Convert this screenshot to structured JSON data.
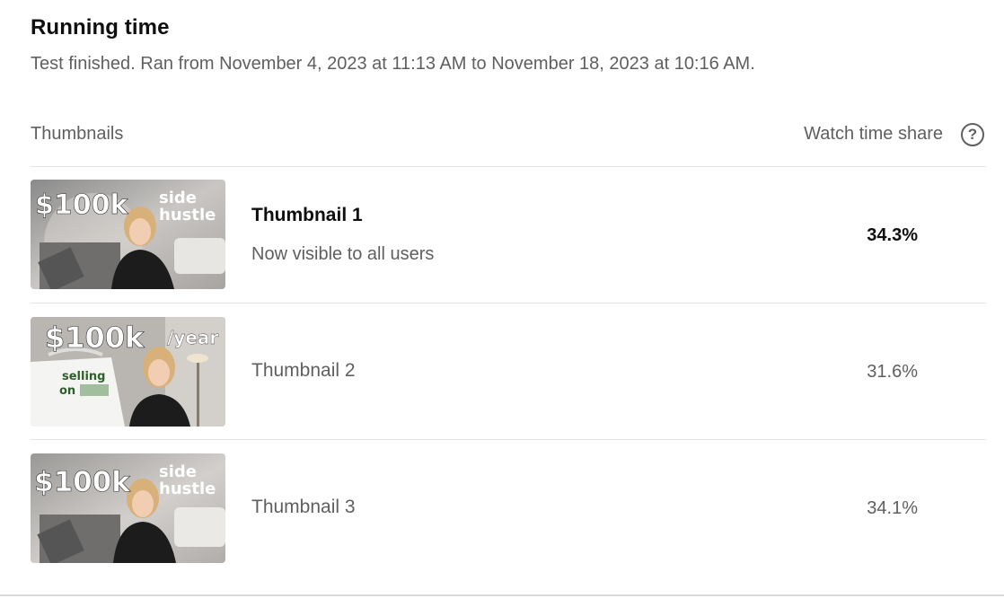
{
  "running_time": {
    "title": "Running time",
    "description": "Test finished. Ran from November 4, 2023 at 11:13 AM to November 18, 2023 at 10:16 AM."
  },
  "table": {
    "col_thumbnails": "Thumbnails",
    "col_watch_share": "Watch time share",
    "help_glyph": "?"
  },
  "rows": [
    {
      "label": "Thumbnail 1",
      "status": "Now visible to all users",
      "share": "34.3%",
      "thumb_text": {
        "big": "$100k",
        "small1": "side",
        "small2": "hustle"
      }
    },
    {
      "label": "Thumbnail 2",
      "share": "31.6%",
      "thumb_text": {
        "big": "$100k",
        "small1": "/year",
        "shirt1": "selling",
        "shirt2": "on"
      }
    },
    {
      "label": "Thumbnail 3",
      "share": "34.1%",
      "thumb_text": {
        "big": "$100k",
        "small1": "side",
        "small2": "hustle"
      }
    }
  ]
}
